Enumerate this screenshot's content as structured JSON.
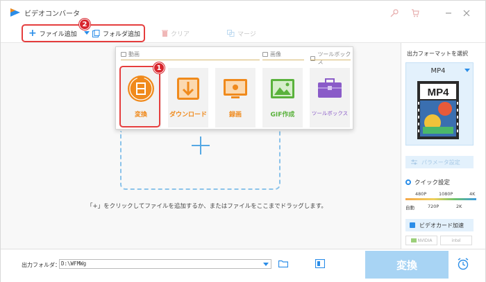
{
  "app": {
    "title": "ビデオコンバータ"
  },
  "toolbar": {
    "add_file": "ファイル追加",
    "add_folder": "フォルダ追加",
    "clear": "クリア",
    "merge": "マージ",
    "badge": "2"
  },
  "popup": {
    "sections": {
      "video": "動画",
      "image": "画像",
      "toolbox": "ツールボックス"
    },
    "tiles": [
      {
        "label": "変換",
        "color": "#f08a1c"
      },
      {
        "label": "ダウンロード",
        "color": "#f08a1c"
      },
      {
        "label": "録画",
        "color": "#f08a1c"
      },
      {
        "label": "GIF作成",
        "color": "#5ab23c"
      },
      {
        "label": "ツールボックス",
        "color": "#8a5bc8"
      }
    ],
    "badge": "1"
  },
  "main": {
    "hint": "「+」をクリックしてファイルを追加するか、またはファイルをここまでドラッグします。"
  },
  "right_panel": {
    "output_format_title": "出力フォーマットを選択",
    "format_name": "MP4",
    "format_icon_text": "MP4",
    "param_button": "パラメータ設定",
    "quick_setting": "クイック設定",
    "slider_top": [
      "480P",
      "1080P",
      "4K"
    ],
    "slider_bottom": [
      "自動",
      "720P",
      "2K"
    ],
    "gpu_button": "ビデオカード加速",
    "vendors": [
      "NVIDIA",
      "intel"
    ]
  },
  "bottom": {
    "output_folder_label": "出力フォルダ：",
    "output_path": "D:\\WFMWg",
    "convert_label": "変換"
  },
  "colors": {
    "accent": "#2a8de8",
    "highlight": "#e53d3d",
    "convert_disabled": "#a8d4f4"
  }
}
